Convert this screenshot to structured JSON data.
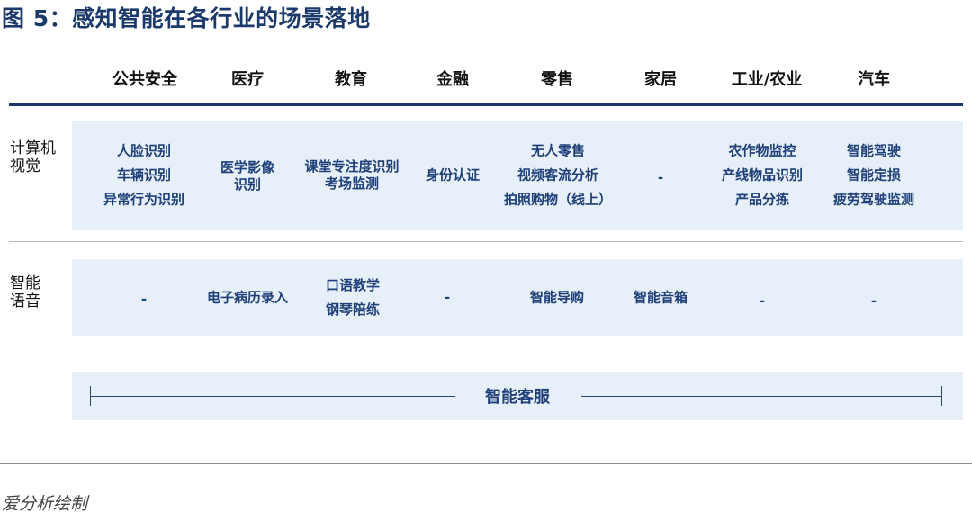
{
  "title": "图 5：感知智能在各行业的场景落地",
  "columns": [
    "公共安全",
    "医疗",
    "教育",
    "金融",
    "零售",
    "家居",
    "工业/农业",
    "汽车"
  ],
  "rows": [
    {
      "label_lines": [
        "计算机",
        "视觉"
      ],
      "cells": [
        [
          "人脸识别",
          "车辆识别",
          "异常行为识别"
        ],
        [
          "医学影像",
          "识别"
        ],
        [
          "课堂专注度识别",
          "考场监测"
        ],
        [
          "身份认证"
        ],
        [
          "无人零售",
          "视频客流分析",
          "拍照购物（线上）"
        ],
        [
          "-"
        ],
        [
          "农作物监控",
          "产线物品识别",
          "产品分拣"
        ],
        [
          "智能驾驶",
          "智能定损",
          "疲劳驾驶监测"
        ]
      ]
    },
    {
      "label_lines": [
        "智能",
        "语音"
      ],
      "cells": [
        [
          "-"
        ],
        [
          "电子病历录入"
        ],
        [
          "口语教学",
          "钢琴陪练"
        ],
        [
          "-"
        ],
        [
          "智能导购"
        ],
        [
          "智能音箱"
        ],
        [
          "-"
        ],
        [
          "-"
        ]
      ]
    }
  ],
  "span_row": {
    "label": "智能客服"
  },
  "source": "爱分析绘制",
  "colors": {
    "title": "#1b3a6b",
    "cell_text": "#1e3f78",
    "band": "#e7eff8",
    "rule": "#1b3a6b"
  }
}
